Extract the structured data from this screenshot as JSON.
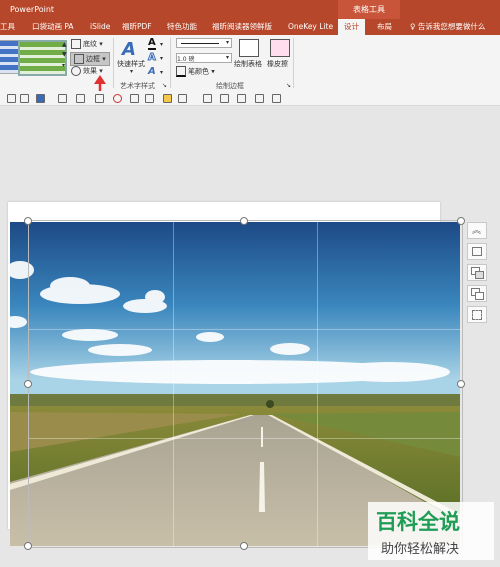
{
  "titlebar": {
    "app_title": "PowerPoint",
    "context_group": "表格工具"
  },
  "tabs": [
    {
      "label": "工具"
    },
    {
      "label": "口袋动画 PA"
    },
    {
      "label": "iSlide"
    },
    {
      "label": "福昕PDF"
    },
    {
      "label": "特色功能"
    },
    {
      "label": "福昕阅读器领鲜版"
    },
    {
      "label": "OneKey Lite"
    },
    {
      "label": "设计"
    },
    {
      "label": "布局"
    }
  ],
  "tell_me": {
    "text": "告诉我您想要做什么"
  },
  "ribbon": {
    "shading_label": "底纹",
    "border_label": "边框",
    "effects_label": "效果",
    "quick_styles_label": "快速样式",
    "wordart_group_label": "艺术字样式",
    "pen_weight_label": "1.0 磅",
    "pen_color_label": "笔颜色",
    "draw_table_label": "绘制表格",
    "eraser_label": "橡皮擦",
    "draw_borders_group_label": "绘制边框"
  },
  "watermark": {
    "line1": "百科全说",
    "line2": "助你轻松解决"
  },
  "colors": {
    "accent": "#b7472a",
    "arrow": "#e03030"
  }
}
